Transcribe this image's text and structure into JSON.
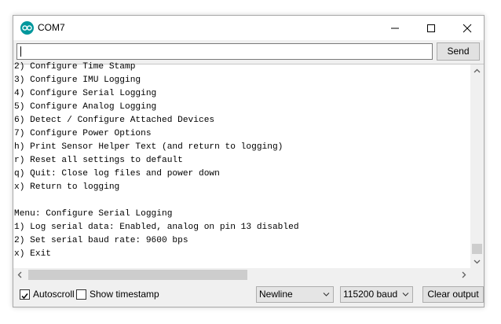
{
  "window": {
    "title": "COM7",
    "app_icon": "arduino-icon",
    "accent_color": "#00979c",
    "controls": [
      "minimize-icon",
      "maximize-icon",
      "close-icon"
    ]
  },
  "toolbar": {
    "input_value": "",
    "send_label": "Send"
  },
  "output": {
    "lines": [
      "2) Configure Time Stamp",
      "3) Configure IMU Logging",
      "4) Configure Serial Logging",
      "5) Configure Analog Logging",
      "6) Detect / Configure Attached Devices",
      "7) Configure Power Options",
      "h) Print Sensor Helper Text (and return to logging)",
      "r) Reset all settings to default",
      "q) Quit: Close log files and power down",
      "x) Return to logging",
      "",
      "Menu: Configure Serial Logging",
      "1) Log serial data: Enabled, analog on pin 13 disabled",
      "2) Set serial baud rate: 9600 bps",
      "x) Exit"
    ]
  },
  "scroll": {
    "vertical_position": 1.0,
    "horizontal_position": 0.0
  },
  "statusbar": {
    "autoscroll_label": "Autoscroll",
    "autoscroll_checked": true,
    "timestamp_label": "Show timestamp",
    "timestamp_checked": false,
    "line_ending_value": "Newline",
    "baud_value": "115200 baud",
    "clear_label": "Clear output"
  }
}
